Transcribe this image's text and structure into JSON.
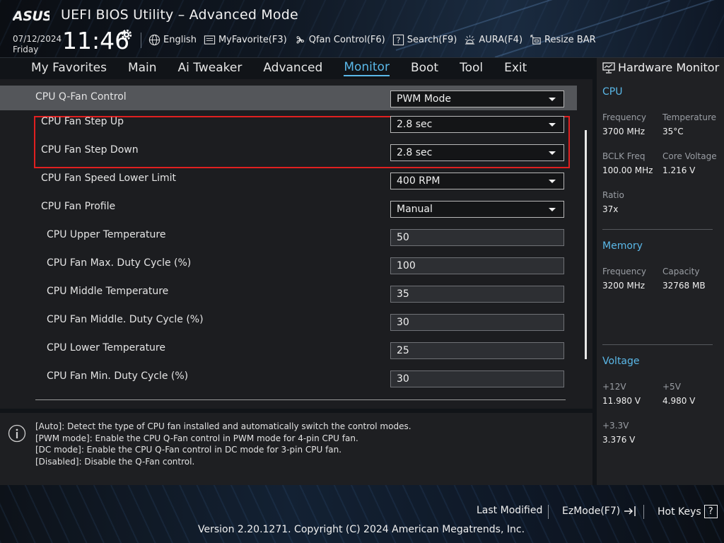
{
  "header": {
    "brand": "ASUS",
    "title": "UEFI BIOS Utility – Advanced Mode",
    "date": "07/12/2024",
    "day": "Friday",
    "time": "11:46",
    "toolbar": [
      {
        "label": "English",
        "icon": "globe-icon"
      },
      {
        "label": "MyFavorite(F3)",
        "icon": "favorite-list-icon"
      },
      {
        "label": "Qfan Control(F6)",
        "icon": "fan-icon"
      },
      {
        "label": "Search(F9)",
        "icon": "search-help-icon"
      },
      {
        "label": "AURA(F4)",
        "icon": "aura-light-icon"
      },
      {
        "label": "Resize BAR",
        "icon": "resize-bar-icon"
      }
    ]
  },
  "tabs": [
    "My Favorites",
    "Main",
    "Ai Tweaker",
    "Advanced",
    "Monitor",
    "Boot",
    "Tool",
    "Exit"
  ],
  "active_tab": "Monitor",
  "settings": [
    {
      "label": "CPU Q-Fan Control",
      "value": "PWM Mode",
      "type": "dropdown",
      "highlighted": true
    },
    {
      "label": "CPU Fan Step Up",
      "value": "2.8 sec",
      "type": "dropdown",
      "boxed": true
    },
    {
      "label": "CPU Fan Step Down",
      "value": "2.8 sec",
      "type": "dropdown",
      "boxed": true
    },
    {
      "label": "CPU Fan Speed Lower Limit",
      "value": "400 RPM",
      "type": "dropdown"
    },
    {
      "label": "CPU Fan Profile",
      "value": "Manual",
      "type": "dropdown"
    },
    {
      "label": "CPU Upper Temperature",
      "value": "50",
      "type": "number"
    },
    {
      "label": "CPU Fan Max. Duty Cycle (%)",
      "value": "100",
      "type": "number"
    },
    {
      "label": "CPU Middle Temperature",
      "value": "35",
      "type": "number"
    },
    {
      "label": "CPU Fan Middle. Duty Cycle (%)",
      "value": "30",
      "type": "number"
    },
    {
      "label": "CPU Lower Temperature",
      "value": "25",
      "type": "number"
    },
    {
      "label": "CPU Fan Min. Duty Cycle (%)",
      "value": "30",
      "type": "number"
    }
  ],
  "help": {
    "lines": [
      "[Auto]: Detect the type of CPU fan installed and automatically switch the control modes.",
      "[PWM mode]: Enable the CPU Q-Fan control in PWM mode for 4-pin CPU fan.",
      "[DC mode]: Enable the CPU Q-Fan control in DC mode for 3-pin CPU fan.",
      "[Disabled]: Disable the Q-Fan control."
    ]
  },
  "hardware_monitor": {
    "title": "Hardware Monitor",
    "cpu": {
      "heading": "CPU",
      "frequency_label": "Frequency",
      "frequency": "3700 MHz",
      "temperature_label": "Temperature",
      "temperature": "35°C",
      "bclk_label": "BCLK Freq",
      "bclk": "100.00 MHz",
      "core_voltage_label": "Core Voltage",
      "core_voltage": "1.216 V",
      "ratio_label": "Ratio",
      "ratio": "37x"
    },
    "memory": {
      "heading": "Memory",
      "frequency_label": "Frequency",
      "frequency": "3200 MHz",
      "capacity_label": "Capacity",
      "capacity": "32768 MB"
    },
    "voltage": {
      "heading": "Voltage",
      "v12_label": "+12V",
      "v12": "11.980 V",
      "v5_label": "+5V",
      "v5": "4.980 V",
      "v33_label": "+3.3V",
      "v33": "3.376 V"
    }
  },
  "footer": {
    "last_modified": "Last Modified",
    "ezmode": "EzMode(F7)",
    "hotkeys": "Hot Keys",
    "hotkeys_icon": "?",
    "version": "Version 2.20.1271. Copyright (C) 2024 American Megatrends, Inc."
  },
  "colors": {
    "accent": "#5ab8e8",
    "highlight_row": "#54565a",
    "red_box": "#e02020",
    "panel_bg": "#1c1d20"
  }
}
